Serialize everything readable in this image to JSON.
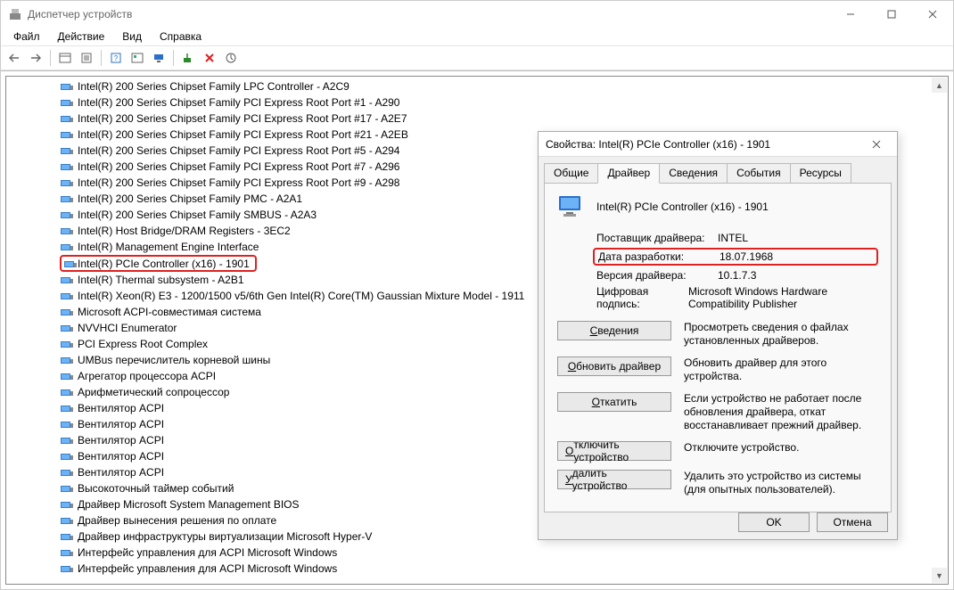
{
  "window": {
    "title": "Диспетчер устройств"
  },
  "menubar": [
    "Файл",
    "Действие",
    "Вид",
    "Справка"
  ],
  "tree": {
    "items": [
      "Intel(R) 200 Series Chipset Family LPC Controller - A2C9",
      "Intel(R) 200 Series Chipset Family PCI Express Root Port #1 - A290",
      "Intel(R) 200 Series Chipset Family PCI Express Root Port #17 - A2E7",
      "Intel(R) 200 Series Chipset Family PCI Express Root Port #21 - A2EB",
      "Intel(R) 200 Series Chipset Family PCI Express Root Port #5 - A294",
      "Intel(R) 200 Series Chipset Family PCI Express Root Port #7 - A296",
      "Intel(R) 200 Series Chipset Family PCI Express Root Port #9 - A298",
      "Intel(R) 200 Series Chipset Family PMC - A2A1",
      "Intel(R) 200 Series Chipset Family SMBUS - A2A3",
      "Intel(R) Host Bridge/DRAM Registers - 3EC2",
      "Intel(R) Management Engine Interface",
      "Intel(R) PCIe Controller (x16) - 1901",
      "Intel(R) Thermal subsystem - A2B1",
      "Intel(R) Xeon(R) E3 - 1200/1500 v5/6th Gen Intel(R) Core(TM) Gaussian Mixture Model - 1911",
      "Microsoft ACPI-совместимая система",
      "NVVHCI Enumerator",
      "PCI Express Root Complex",
      "UMBus перечислитель корневой шины",
      "Агрегатор процессора ACPI",
      "Арифметический сопроцессор",
      "Вентилятор ACPI",
      "Вентилятор ACPI",
      "Вентилятор ACPI",
      "Вентилятор ACPI",
      "Вентилятор ACPI",
      "Высокоточный таймер событий",
      "Драйвер Microsoft System Management BIOS",
      "Драйвер вынесения решения по оплате",
      "Драйвер инфраструктуры виртуализации Microsoft Hyper-V",
      "Интерфейс управления для ACPI Microsoft Windows",
      "Интерфейс управления для ACPI Microsoft Windows"
    ],
    "highlight_index": 11
  },
  "dialog": {
    "title": "Свойства: Intel(R) PCIe Controller (x16) - 1901",
    "tabs": [
      "Общие",
      "Драйвер",
      "Сведения",
      "События",
      "Ресурсы"
    ],
    "active_tab": 1,
    "device_name": "Intel(R) PCIe Controller (x16) - 1901",
    "rows": [
      {
        "label": "Поставщик драйвера:",
        "value": "INTEL"
      },
      {
        "label": "Дата разработки:",
        "value": "18.07.1968"
      },
      {
        "label": "Версия драйвера:",
        "value": "10.1.7.3"
      },
      {
        "label": "Цифровая подпись:",
        "value": "Microsoft Windows Hardware Compatibility Publisher"
      }
    ],
    "highlight_row": 1,
    "buttons": [
      {
        "label": "Сведения",
        "desc": "Просмотреть сведения о файлах установленных драйверов."
      },
      {
        "label": "Обновить драйвер",
        "desc": "Обновить драйвер для этого устройства."
      },
      {
        "label": "Откатить",
        "desc": "Если устройство не работает после обновления драйвера, откат восстанавливает прежний драйвер."
      },
      {
        "label": "Отключить устройство",
        "desc": "Отключите устройство."
      },
      {
        "label": "Удалить устройство",
        "desc": "Удалить это устройство из системы (для опытных пользователей)."
      }
    ],
    "footer": {
      "ok": "OK",
      "cancel": "Отмена"
    }
  }
}
